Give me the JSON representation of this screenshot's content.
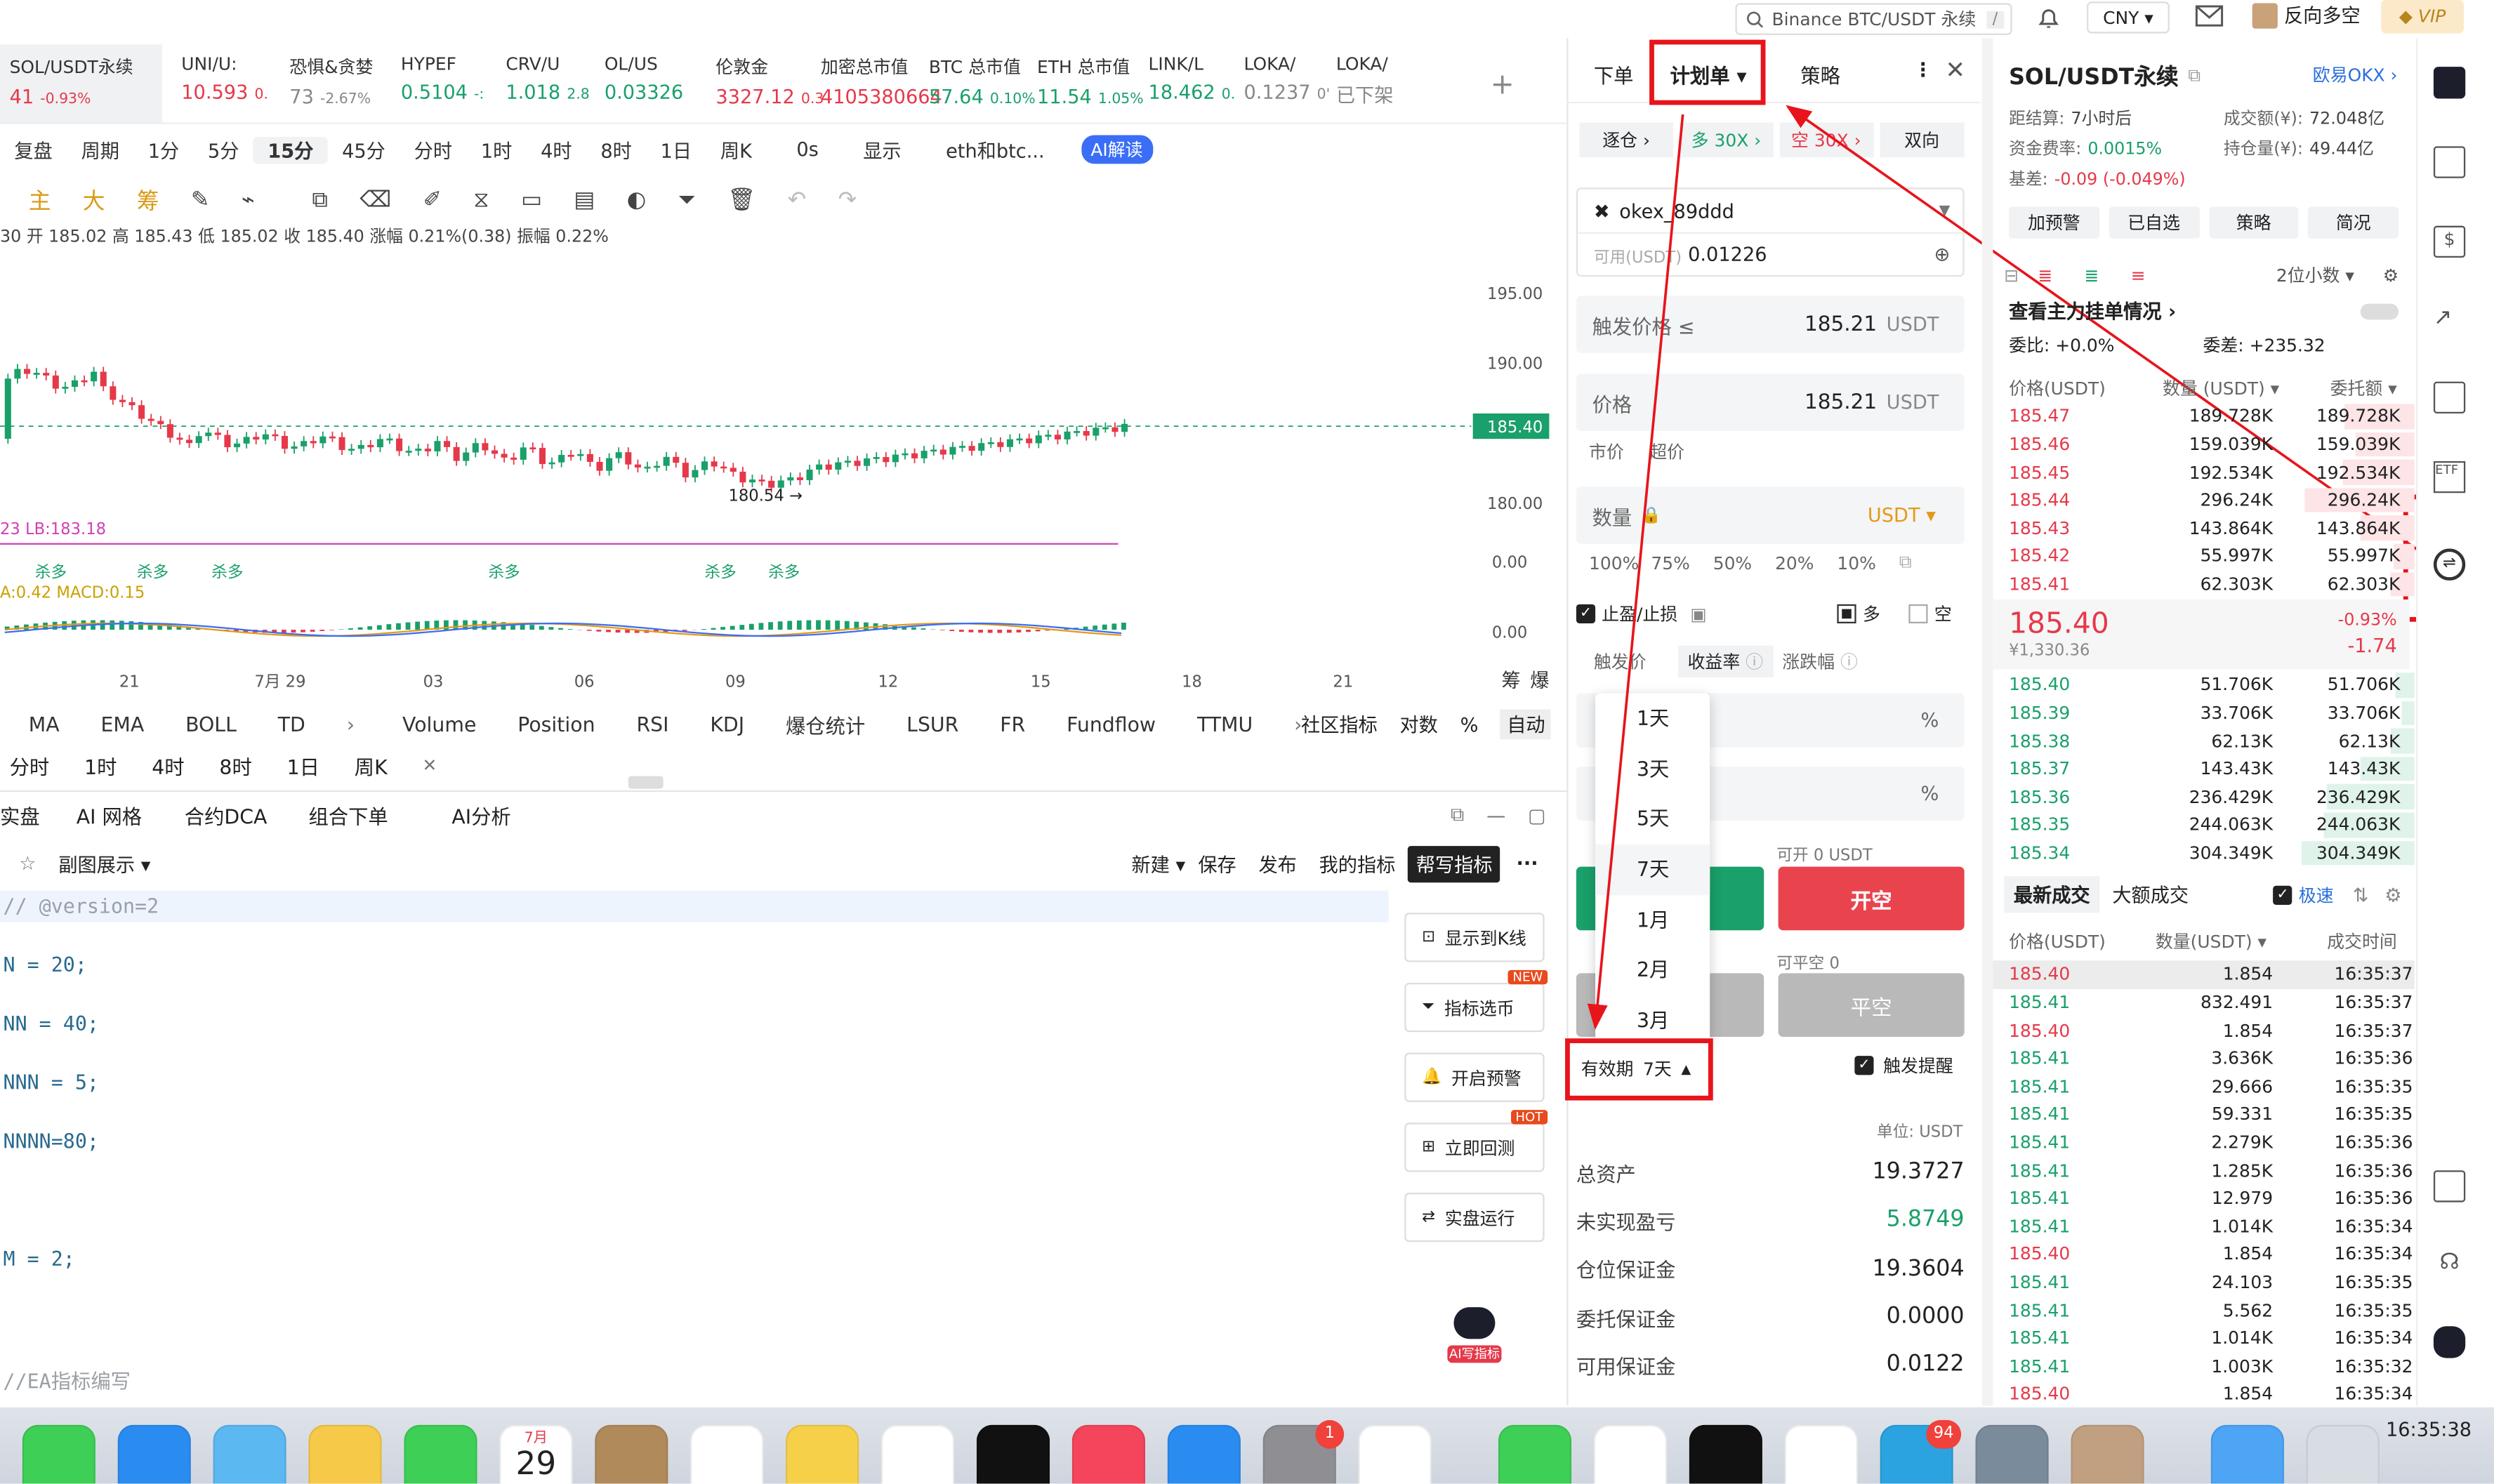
{
  "topbar": {
    "search_placeholder": "Binance BTC/USDT 永续",
    "search_key": "/",
    "currency": "CNY",
    "user": "反向多空",
    "vip": "VIP"
  },
  "tickers": [
    {
      "name": "SOL/USDT永续",
      "price": "41",
      "change": "-0.93%",
      "color": "red"
    },
    {
      "name": "UNI/U:",
      "price": "10.593",
      "change": "0.",
      "color": "red"
    },
    {
      "name": "恐惧&贪婪",
      "price": "73",
      "change": "-2.67%",
      "color": "gray"
    },
    {
      "name": "HYPEF",
      "price": "0.5104",
      "change": "-:",
      "color": "green"
    },
    {
      "name": "CRV/U",
      "price": "1.018",
      "change": "2.8",
      "color": "green"
    },
    {
      "name": "OL/US",
      "price": "0.03326",
      "change": "",
      "color": "green"
    },
    {
      "name": "伦敦金",
      "price": "3327.12",
      "change": "0.3",
      "color": "red"
    },
    {
      "name": "加密总市值",
      "price": "4105380664",
      "change": "",
      "color": "red"
    },
    {
      "name": "BTC 总市值",
      "price": "57.64",
      "change": "0.10%",
      "color": "green"
    },
    {
      "name": "ETH 总市值",
      "price": "11.54",
      "change": "1.05%",
      "color": "green"
    },
    {
      "name": "LINK/L",
      "price": "18.462",
      "change": "0.",
      "color": "green"
    },
    {
      "name": "LOKA/",
      "price": "0.1237",
      "change": "0'",
      "color": "gray"
    },
    {
      "name": "LOKA/",
      "price": "已下架",
      "change": "",
      "color": "gray"
    }
  ],
  "chart_toolbar": [
    "复盘",
    "周期",
    "1分",
    "5分",
    "15分",
    "45分",
    "分时",
    "1时",
    "4时",
    "8时",
    "1日",
    "周K",
    "0s",
    "显示",
    "eth和btc...",
    "AI解读"
  ],
  "draw_toolbar": {
    "labels": [
      "主",
      "大",
      "筹"
    ]
  },
  "ohlc_line": "30 开 185.02 高 185.43 低 185.02 收 185.40 涨幅 0.21%(0.38) 振幅 0.22%",
  "chart_data": {
    "type": "candlestick",
    "price_axis": [
      "195.00",
      "190.00",
      "185.40",
      "180.00"
    ],
    "current_price": "185.40",
    "low_label": "180.54",
    "x_labels": [
      "21",
      "7月 29",
      "03",
      "06",
      "09",
      "12",
      "15",
      "18",
      "21"
    ],
    "lb_label": "23  LB:183.18",
    "macd_label": "A:0.42  MACD:0.15",
    "sub_axis": [
      "0.00",
      "0.00"
    ],
    "kill_labels": [
      "杀多",
      "杀多",
      "杀多",
      "杀多",
      "杀多",
      "杀多"
    ],
    "corner": [
      "筹",
      "爆"
    ]
  },
  "indicator_tabs": [
    "MA",
    "EMA",
    "BOLL",
    "TD",
    "Volume",
    "Position",
    "RSI",
    "KDJ",
    "爆仓统计",
    "LSUR",
    "FR",
    "Fundflow",
    "TTMU"
  ],
  "indicator_right": [
    "社区指标",
    "对数",
    "%",
    "自动"
  ],
  "period_row": [
    "分时",
    "1时",
    "4时",
    "8时",
    "1日",
    "周K"
  ],
  "bottom_tabs": [
    "实盘",
    "AI 网格",
    "合约DCA",
    "组合下单",
    "AI分析"
  ],
  "editor_toolbar": {
    "left": "副图展示",
    "buttons": [
      "新建",
      "保存",
      "发布",
      "我的指标"
    ],
    "primary": "帮写指标"
  },
  "code_lines": [
    "// @version=2",
    "N = 20;",
    "NN = 40;",
    "NNN = 5;",
    "NNNN=80;",
    "M = 2;",
    "//EA指标编写"
  ],
  "editor_side": [
    {
      "label": "显示到K线",
      "badge": ""
    },
    {
      "label": "指标选币",
      "badge": "NEW"
    },
    {
      "label": "开启预警",
      "badge": ""
    },
    {
      "label": "立即回测",
      "badge": "HOT"
    },
    {
      "label": "实盘运行",
      "badge": ""
    }
  ],
  "ai_write": "AI写指标",
  "order": {
    "tabs": [
      "下单",
      "计划单",
      "策略"
    ],
    "mode": [
      "逐仓",
      "多 30X",
      "空 30X",
      "双向"
    ],
    "account": "okex_89ddd",
    "avail_label": "可用(USDT)",
    "avail": "0.01226",
    "trigger_label": "触发价格 ≤",
    "trigger": "185.21",
    "unit": "USDT",
    "price_label": "价格",
    "price": "185.21",
    "market": "市价",
    "over": "超价",
    "qty_label": "数量",
    "qty_unit": "USDT",
    "pcts": [
      "100%",
      "75%",
      "50%",
      "20%",
      "10%"
    ],
    "tpsl": "止盈/止损",
    "long": "多",
    "short": "空",
    "tp_tabs": [
      "触发价",
      "收益率",
      "涨跌幅"
    ],
    "dropdown": [
      "1天",
      "3天",
      "5天",
      "7天",
      "1月",
      "2月",
      "3月"
    ],
    "can_open": "可开 0 USDT",
    "open_btn": "开空",
    "can_close": "可平空 0",
    "close_btn": "平空",
    "validity_label": "有效期",
    "validity": "7天",
    "alert": "触发提醒",
    "unit_label": "单位: USDT",
    "assets": [
      {
        "k": "总资产",
        "v": "19.3727",
        "c": ""
      },
      {
        "k": "未实现盈亏",
        "v": "5.8749",
        "c": "green"
      },
      {
        "k": "仓位保证金",
        "v": "19.3604",
        "c": ""
      },
      {
        "k": "委托保证金",
        "v": "0.0000",
        "c": ""
      },
      {
        "k": "可用保证金",
        "v": "0.0122",
        "c": ""
      }
    ]
  },
  "book": {
    "title": "SOL/USDT永续",
    "exchange": "欧易OKX",
    "info": [
      {
        "k": "距结算:",
        "v": "7小时后"
      },
      {
        "k": "成交额(¥):",
        "v": "72.048亿"
      },
      {
        "k": "资金费率:",
        "v": "0.0015%"
      },
      {
        "k": "持仓量(¥):",
        "v": "49.44亿"
      },
      {
        "k": "基差:",
        "v": "-0.09 (-0.049%)"
      }
    ],
    "btns": [
      "加预警",
      "已自选",
      "策略",
      "简况"
    ],
    "precision": "2位小数",
    "main_orders": "查看主力挂单情况",
    "ratio": "委比: +0.0%",
    "diff": "委差: +235.32",
    "head": [
      "价格(USDT)",
      "数量 (USDT)",
      "委托额"
    ],
    "asks": [
      [
        "185.47",
        "189.728K",
        "189.728K"
      ],
      [
        "185.46",
        "159.039K",
        "159.039K"
      ],
      [
        "185.45",
        "192.534K",
        "192.534K"
      ],
      [
        "185.44",
        "296.24K",
        "296.24K"
      ],
      [
        "185.43",
        "143.864K",
        "143.864K"
      ],
      [
        "185.42",
        "55.997K",
        "55.997K"
      ],
      [
        "185.41",
        "62.303K",
        "62.303K"
      ]
    ],
    "last": "185.40",
    "last_cny": "¥1,330.36",
    "last_pct": "-0.93%",
    "last_chg": "-1.74",
    "bids": [
      [
        "185.40",
        "51.706K",
        "51.706K"
      ],
      [
        "185.39",
        "33.706K",
        "33.706K"
      ],
      [
        "185.38",
        "62.13K",
        "62.13K"
      ],
      [
        "185.37",
        "143.43K",
        "143.43K"
      ],
      [
        "185.36",
        "236.429K",
        "236.429K"
      ],
      [
        "185.35",
        "244.063K",
        "244.063K"
      ],
      [
        "185.34",
        "304.349K",
        "304.349K"
      ]
    ],
    "trade_tabs": [
      "最新成交",
      "大额成交"
    ],
    "fast": "极速",
    "trade_head": [
      "价格(USDT)",
      "数量(USDT)",
      "成交时间"
    ],
    "trades": [
      [
        "185.40",
        "1.854",
        "16:35:37",
        "red"
      ],
      [
        "185.41",
        "832.491",
        "16:35:37",
        "green"
      ],
      [
        "185.40",
        "1.854",
        "16:35:37",
        "red"
      ],
      [
        "185.41",
        "3.636K",
        "16:35:36",
        "green"
      ],
      [
        "185.41",
        "29.666",
        "16:35:35",
        "green"
      ],
      [
        "185.41",
        "59.331",
        "16:35:35",
        "green"
      ],
      [
        "185.41",
        "2.279K",
        "16:35:36",
        "green"
      ],
      [
        "185.41",
        "1.285K",
        "16:35:36",
        "green"
      ],
      [
        "185.41",
        "12.979",
        "16:35:36",
        "green"
      ],
      [
        "185.41",
        "1.014K",
        "16:35:34",
        "green"
      ],
      [
        "185.40",
        "1.854",
        "16:35:34",
        "red"
      ],
      [
        "185.41",
        "24.103",
        "16:35:35",
        "green"
      ],
      [
        "185.41",
        "5.562",
        "16:35:35",
        "green"
      ],
      [
        "185.41",
        "1.014K",
        "16:35:34",
        "green"
      ],
      [
        "185.41",
        "1.003K",
        "16:35:32",
        "green"
      ],
      [
        "185.40",
        "1.854",
        "16:35:34",
        "red"
      ]
    ]
  },
  "clock": "16:35:38",
  "dock": {
    "calendar_month": "7月",
    "calendar_day": "29",
    "settings_badge": "1",
    "wechat_badge": "94"
  }
}
